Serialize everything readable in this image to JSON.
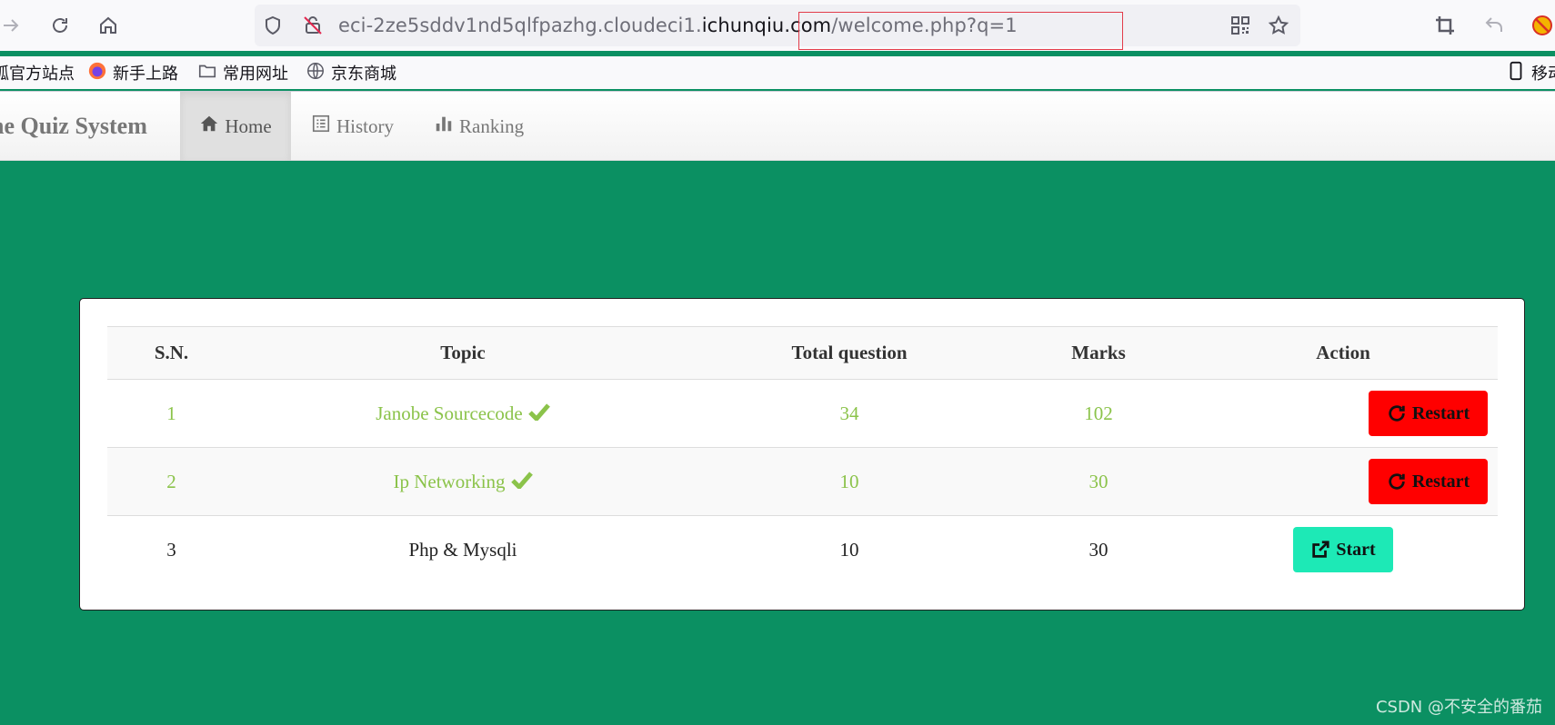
{
  "browser": {
    "url_prefix": "eci-2ze5sddv1nd5qlfpazhg.cloudeci1.",
    "url_domain": "ichunqiu.com",
    "url_path": "/welcome.php?q=1",
    "bookmarks": [
      "狐官方站点",
      "新手上路",
      "常用网址",
      "京东商城"
    ],
    "mobile_bookmarks": "移动"
  },
  "navbar": {
    "brand": "ne Quiz System",
    "items": [
      {
        "label": "Home",
        "icon": "home-icon",
        "active": true
      },
      {
        "label": "History",
        "icon": "list-icon",
        "active": false
      },
      {
        "label": "Ranking",
        "icon": "bar-chart-icon",
        "active": false
      }
    ]
  },
  "table": {
    "headers": [
      "S.N.",
      "Topic",
      "Total question",
      "Marks",
      "Action"
    ],
    "rows": [
      {
        "sn": "1",
        "topic": "Janobe Sourcecode",
        "total": "34",
        "marks": "102",
        "action": "Restart",
        "done": true
      },
      {
        "sn": "2",
        "topic": "Ip Networking",
        "total": "10",
        "marks": "30",
        "action": "Restart",
        "done": true
      },
      {
        "sn": "3",
        "topic": "Php & Mysqli",
        "total": "10",
        "marks": "30",
        "action": "Start",
        "done": false
      }
    ]
  },
  "colors": {
    "background": "#0b9062",
    "done_text": "#8bc34a",
    "restart_button": "#ff0000",
    "start_button": "#1de9b6"
  },
  "watermark": "CSDN @不安全的番茄"
}
